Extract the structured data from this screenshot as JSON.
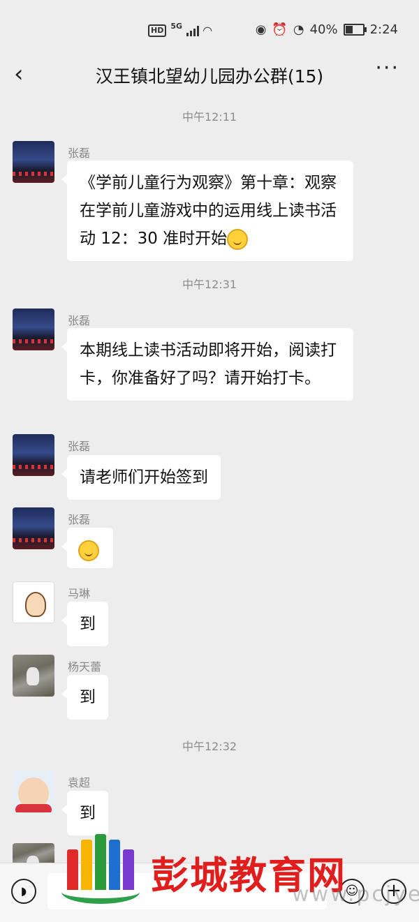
{
  "status_bar": {
    "network_badge": "HD",
    "network_type": "5G",
    "battery_percent": "40%",
    "battery_level": 0.4,
    "time": "2:24"
  },
  "header": {
    "back_icon": "‹",
    "title": "汉王镇北望幼儿园办公群(15)",
    "more_icon": "···"
  },
  "timestamps": [
    "中午12:11",
    "中午12:31",
    "中午12:32"
  ],
  "messages": [
    {
      "sender": "张磊",
      "text": "《学前儿童行为观察》第十章：观察在学前儿童游戏中的运用线上读书活动 12：30 准时开始"
    },
    {
      "sender": "张磊",
      "text": "本期线上读书活动即将开始，阅读打卡，你准备好了吗？请开始打卡。"
    },
    {
      "sender": "张磊",
      "text": "请老师们开始签到"
    },
    {
      "sender": "张磊",
      "text": ""
    },
    {
      "sender": "马琳",
      "text": "到"
    },
    {
      "sender": "杨天蕾",
      "text": "到"
    },
    {
      "sender": "袁超",
      "text": "到"
    }
  ],
  "input_bar": {
    "voice_icon": "voice-icon",
    "emoji_icon": "emoji-icon",
    "plus_icon": "plus-icon"
  },
  "watermark": {
    "name": "彭城教育网",
    "url": "www.pcjyedu.com"
  }
}
